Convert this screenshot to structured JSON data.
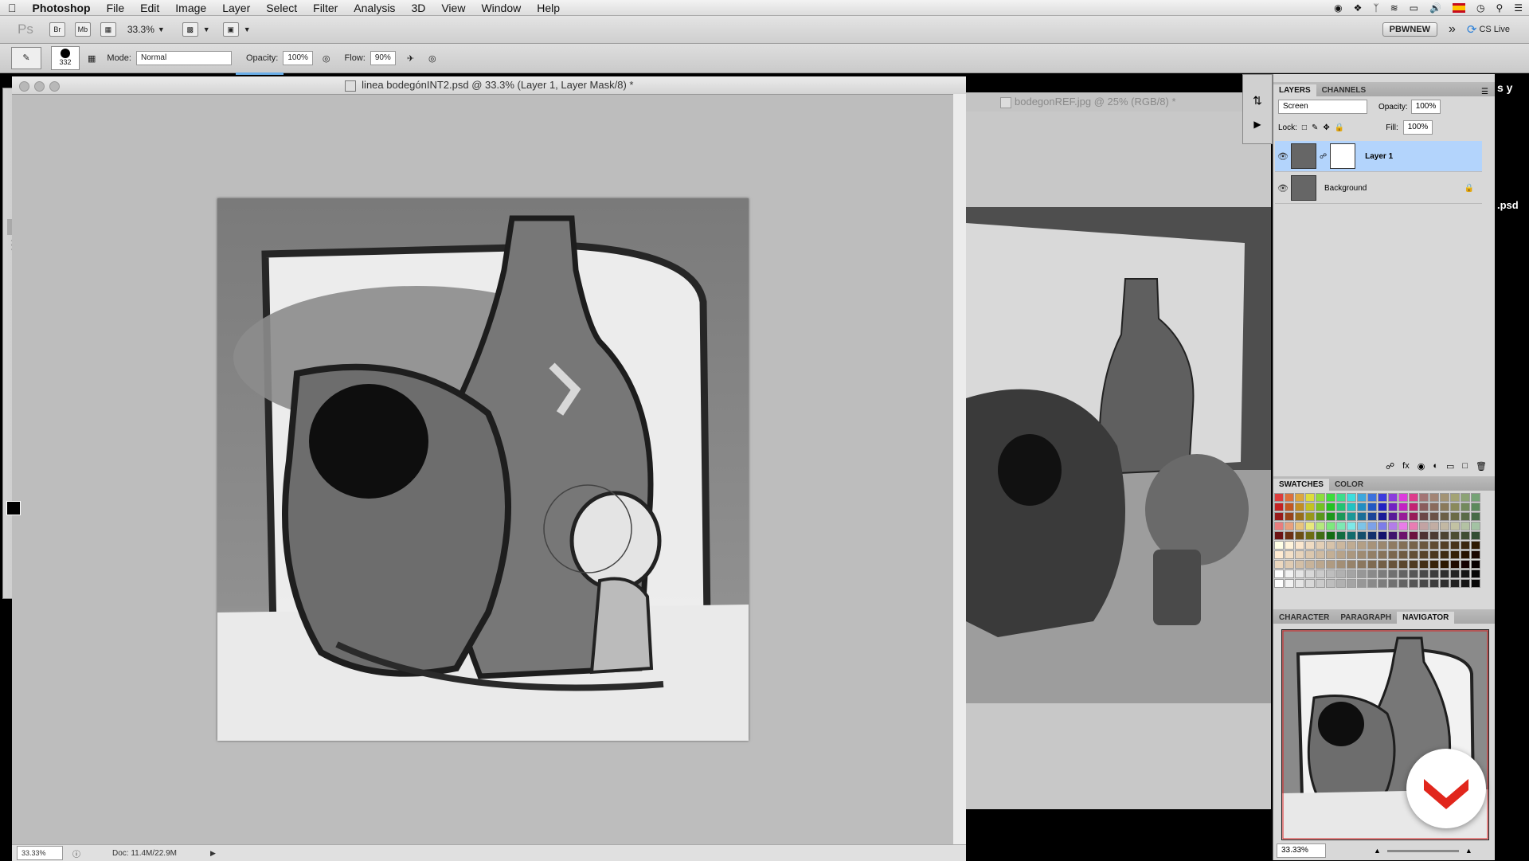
{
  "menubar": {
    "app_name": "Photoshop",
    "items": [
      "File",
      "Edit",
      "Image",
      "Layer",
      "Select",
      "Filter",
      "Analysis",
      "3D",
      "View",
      "Window",
      "Help"
    ]
  },
  "appbar": {
    "ps_label": "Ps",
    "br_label": "Br",
    "mb_label": "Mb",
    "zoom": "33.3%",
    "workspace_button": "PBWNEW",
    "cs_live": "CS Live"
  },
  "options": {
    "brush_size": "332",
    "mode_label": "Mode:",
    "mode_value": "Normal",
    "opacity_label": "Opacity:",
    "opacity_value": "100%",
    "flow_label": "Flow:",
    "flow_value": "90%"
  },
  "document": {
    "title": "linea bodegónINT2.psd @ 33.3% (Layer 1, Layer Mask/8) *",
    "zoom_status": "33.33%",
    "doc_size": "Doc: 11.4M/22.9M"
  },
  "reference": {
    "title": "bodegonREF.jpg @ 25% (RGB/8) *"
  },
  "side_text": {
    "sy": "s y",
    "psd": ".psd"
  },
  "layers_panel": {
    "tabs": [
      "LAYERS",
      "CHANNELS"
    ],
    "blend_mode": "Screen",
    "opacity_label": "Opacity:",
    "opacity_value": "100%",
    "lock_label": "Lock:",
    "fill_label": "Fill:",
    "fill_value": "100%",
    "layers": [
      {
        "name": "Layer 1",
        "selected": true
      },
      {
        "name": "Background",
        "selected": false
      }
    ]
  },
  "swatches_panel": {
    "tabs": [
      "SWATCHES",
      "COLOR"
    ]
  },
  "navigator_panel": {
    "tabs": [
      "CHARACTER",
      "PARAGRAPH",
      "NAVIGATOR"
    ],
    "zoom": "33.33%"
  },
  "colors": {
    "selection": "#b3d4fc",
    "brand_red": "#e1261c"
  },
  "icons": {
    "eye": "eye-icon",
    "lock": "lock-icon",
    "apple": "apple-logo-icon"
  }
}
